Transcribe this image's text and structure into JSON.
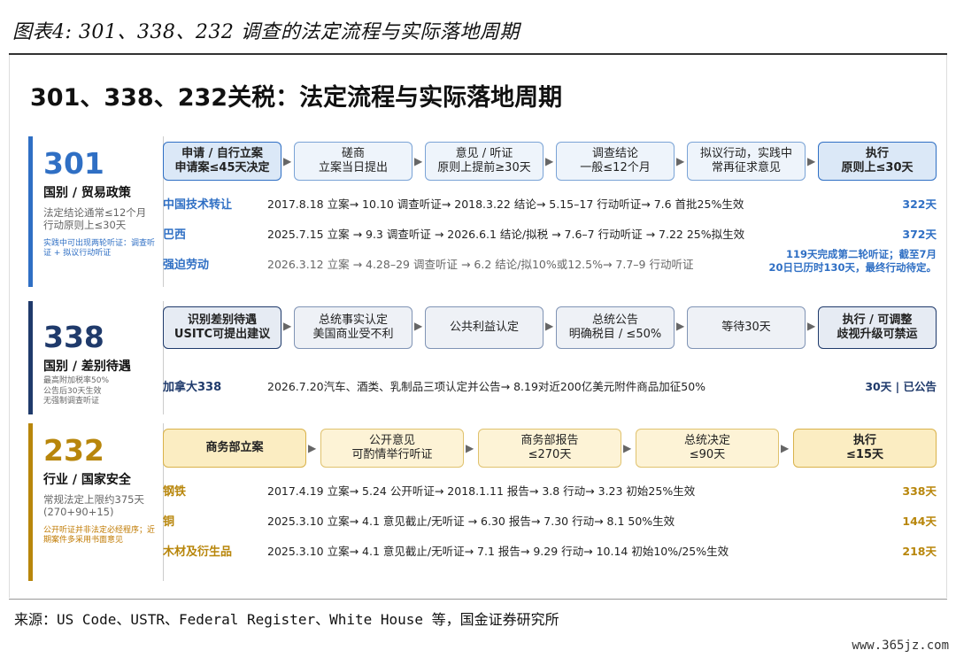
{
  "caption": "图表4: 301、338、232 调查的法定流程与实际落地周期",
  "main_title": "301、338、232关税：法定流程与实际落地周期",
  "source": "来源：US Code、USTR、Federal Register、White House 等，国金证券研究所",
  "watermark": "www.365jz.com",
  "colors": {
    "s301": "#2f6fc4",
    "s338": "#1f3a6b",
    "s232": "#b8860b"
  },
  "s301": {
    "num": "301",
    "sub": "国别 / 贸易政策",
    "note": "法定结论通常≤12个月\n行动原则上≤30天",
    "small": "实践中可出现两轮听证：调查听证 + 拟议行动听证",
    "steps": [
      {
        "l1": "申请 / 自行立案",
        "l2": "申请案≤45天决定"
      },
      {
        "l1": "磋商",
        "l2": "立案当日提出"
      },
      {
        "l1": "意见 / 听证",
        "l2": "原则上提前≥30天"
      },
      {
        "l1": "调查结论",
        "l2": "一般≤12个月"
      },
      {
        "l1": "拟议行动，实践中",
        "l2": "常再征求意见"
      },
      {
        "l1": "执行",
        "l2": "原则上≤30天"
      }
    ],
    "rows": [
      {
        "label": "中国技术转让",
        "text": "2017.8.18 立案→ 10.10 调查听证→ 2018.3.22 结论→ 5.15–17 行动听证→ 7.6 首批25%生效",
        "right": "322天"
      },
      {
        "label": "巴西",
        "text": "2025.7.15 立案 → 9.3 调查听证 → 2026.6.1 结论/拟税 → 7.6–7 行动听证 → 7.22 25%拟生效",
        "right": "372天"
      },
      {
        "label": "强迫劳动",
        "text": "2026.3.12 立案 → 4.28–29 调查听证 → 6.2 结论/拟10%或12.5%→ 7.7–9 行动听证",
        "right1": "119天完成第二轮听证；截至7月",
        "right2": "20日已历时130天，最终行动待定。"
      }
    ]
  },
  "s338": {
    "num": "338",
    "sub": "国别 / 差别待遇",
    "note": "最高附加税率50%\n公告后30天生效\n无强制调查听证",
    "steps": [
      {
        "l1": "识别差别待遇",
        "l2": "USITC可提出建议"
      },
      {
        "l1": "总统事实认定",
        "l2": "美国商业受不利"
      },
      {
        "l1": "公共利益认定",
        "l2": ""
      },
      {
        "l1": "总统公告",
        "l2": "明确税目 / ≤50%"
      },
      {
        "l1": "等待30天",
        "l2": ""
      },
      {
        "l1": "执行 / 可调整",
        "l2": "歧视升级可禁运"
      }
    ],
    "rows": [
      {
        "label": "加拿大338",
        "text": "2026.7.20汽车、酒类、乳制品三项认定并公告→ 8.19对近200亿美元附件商品加征50%",
        "right": "30天 | 已公告"
      }
    ]
  },
  "s232": {
    "num": "232",
    "sub": "行业 / 国家安全",
    "note": "常规法定上限约375天\n(270+90+15)",
    "small": "公开听证并非法定必经程序；近期案件多采用书面意见",
    "steps": [
      {
        "l1": "商务部立案",
        "l2": ""
      },
      {
        "l1": "公开意见",
        "l2": "可酌情举行听证"
      },
      {
        "l1": "商务部报告",
        "l2": "≤270天"
      },
      {
        "l1": "总统决定",
        "l2": "≤90天"
      },
      {
        "l1": "执行",
        "l2": "≤15天"
      }
    ],
    "rows": [
      {
        "label": "钢铁",
        "text": "2017.4.19 立案→ 5.24 公开听证→ 2018.1.11 报告→ 3.8 行动→ 3.23 初始25%生效",
        "right": "338天"
      },
      {
        "label": "铜",
        "text": "2025.3.10 立案→ 4.1 意见截止/无听证 → 6.30 报告→ 7.30 行动→ 8.1 50%生效",
        "right": "144天"
      },
      {
        "label": "木材及衍生品",
        "text": "2025.3.10 立案→ 4.1 意见截止/无听证→ 7.1 报告→ 9.29 行动→ 10.14 初始10%/25%生效",
        "right": "218天"
      }
    ]
  }
}
